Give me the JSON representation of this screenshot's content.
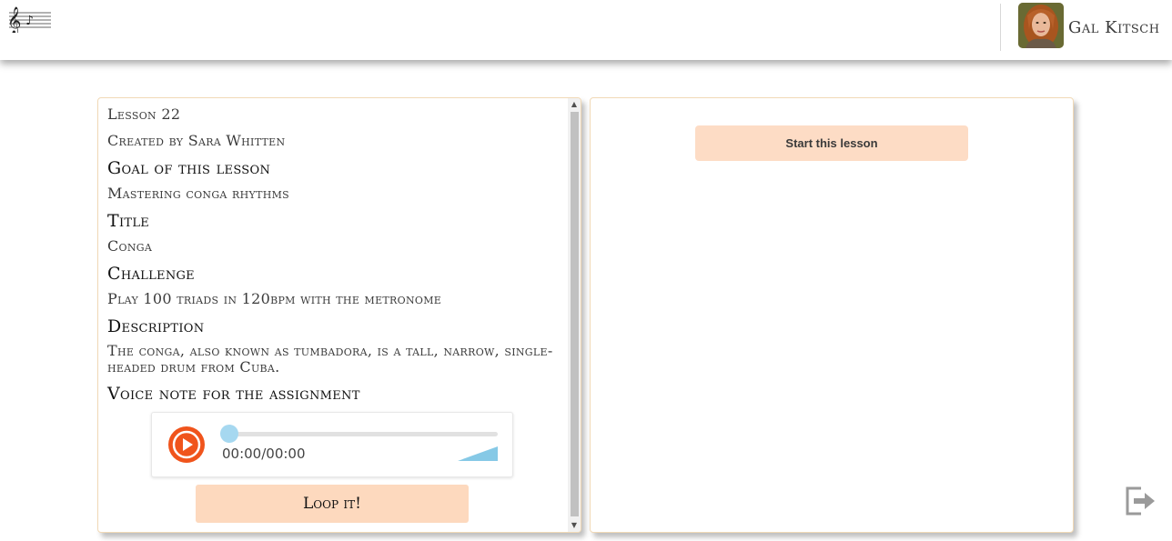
{
  "app": {
    "logo_icon": "music-staff-icon"
  },
  "user": {
    "name": "Gal Kitsch",
    "avatar_icon": "user-avatar"
  },
  "lesson": {
    "number": "Lesson 22",
    "created_by": "Created by Sara Whitten",
    "goal_heading": "Goal of this lesson",
    "goal": "Mastering conga rhythms",
    "title_heading": "Title",
    "title": "Conga",
    "challenge_heading": "Challenge",
    "challenge": "Play 100 triads in 120bpm with the metronome",
    "description_heading": "Description",
    "description": "The conga, also known as tumbadora, is a tall, narrow, single-headed drum from Cuba.",
    "voice_note_heading": "Voice note for the assignment"
  },
  "player": {
    "time": "00:00/00:00",
    "progress": 0,
    "accent_color": "#f0541c",
    "track_color": "#a6d8f0",
    "play_icon": "play-icon",
    "volume_icon": "volume-ramp-icon"
  },
  "actions": {
    "loop_label": "Loop it!",
    "start_label": "Start this lesson",
    "logout_icon": "logout-icon"
  },
  "colors": {
    "button_bg": "#fdd9be",
    "panel_border": "#f1d9b6"
  }
}
